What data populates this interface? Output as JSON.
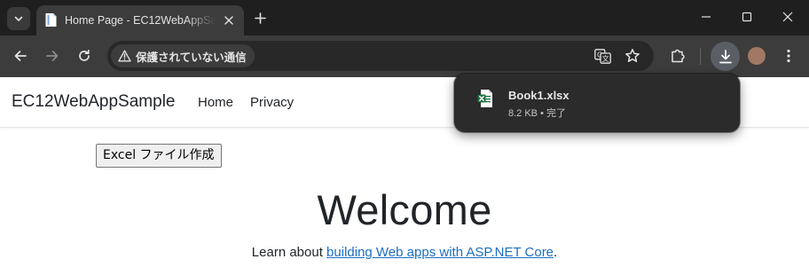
{
  "tab": {
    "title": "Home Page - EC12WebAppSample"
  },
  "omnibox": {
    "security_label": "保護されていない通信"
  },
  "page": {
    "brand": "EC12WebAppSample",
    "nav": [
      "Home",
      "Privacy"
    ],
    "excel_button_label": "Excel ファイル作成",
    "heading": "Welcome",
    "learn_prefix": "Learn about ",
    "learn_link": "building Web apps with ASP.NET Core",
    "learn_suffix": "."
  },
  "download": {
    "file_name": "Book1.xlsx",
    "status": "8.2 KB • 完了"
  },
  "colors": {
    "link": "#1b6ec2",
    "excel_green": "#1d6f42",
    "avatar": "#a17863"
  },
  "icons": {
    "tab_search": "chevron-down-icon",
    "favicon": "document-icon",
    "close": "close-icon",
    "new_tab": "plus-icon",
    "minimize": "minimize-icon",
    "maximize": "maximize-icon",
    "window_close": "close-icon",
    "back": "arrow-left-icon",
    "forward": "arrow-right-icon",
    "reload": "reload-icon",
    "warning": "warning-icon",
    "translate": "translate-icon",
    "bookmark": "star-icon",
    "extensions": "puzzle-icon",
    "download": "download-icon",
    "menu": "kebab-menu-icon",
    "excel": "excel-file-icon"
  }
}
